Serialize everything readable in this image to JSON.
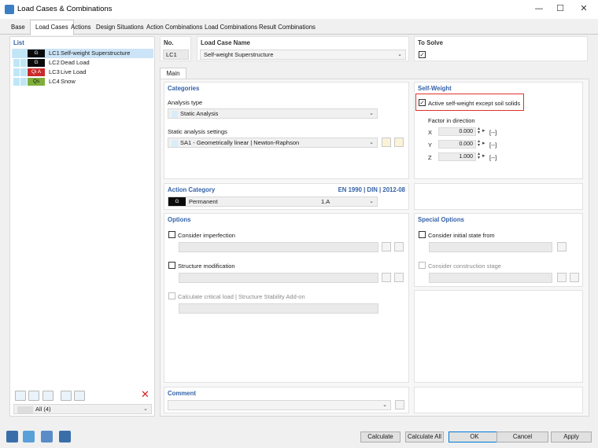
{
  "window": {
    "title": "Load Cases & Combinations",
    "minimize": "—",
    "maximize": "☐",
    "close": "✕"
  },
  "tabs": [
    "Base",
    "Load Cases",
    "Actions",
    "Design Situations",
    "Action Combinations",
    "Load Combinations",
    "Result Combinations"
  ],
  "list": {
    "header": "List",
    "items": [
      {
        "badge": "G",
        "badge_color": "#0b0b0b",
        "code": "LC1",
        "name": "Self-weight Superstructure"
      },
      {
        "badge": "G",
        "badge_color": "#0b0b0b",
        "code": "LC2",
        "name": "Dead Load"
      },
      {
        "badge": "Qi A",
        "badge_color": "#c92b2b",
        "code": "LC3",
        "name": "Live Load"
      },
      {
        "badge": "Qs",
        "badge_color": "#7fae3c",
        "code": "LC4",
        "name": "Snow"
      }
    ],
    "filter": "All (4)"
  },
  "header": {
    "no_label": "No.",
    "no_value": "LC1",
    "name_label": "Load Case Name",
    "name_value": "Self-weight Superstructure",
    "solve_label": "To Solve",
    "solve_checked": "✓"
  },
  "main_tab": "Main",
  "categories": {
    "title": "Categories",
    "analysis_type_label": "Analysis type",
    "analysis_type_value": "Static Analysis",
    "static_settings_label": "Static analysis settings",
    "static_settings_value": "SA1 - Geometrically linear | Newton-Raphson"
  },
  "self_weight": {
    "title": "Self-Weight",
    "active_label": "Active self-weight except soil solids",
    "active_checked": "✓",
    "factor_label": "Factor in direction",
    "x_label": "X",
    "x_value": "0.000",
    "y_label": "Y",
    "y_value": "0.000",
    "z_label": "Z",
    "z_value": "1.000",
    "unit": "[--]"
  },
  "action_category": {
    "title": "Action Category",
    "standard": "EN 1990 | DIN | 2012-08",
    "badge": "G",
    "value": "Permanent",
    "code": "1.A"
  },
  "options": {
    "title": "Options",
    "imperfection": "Consider imperfection",
    "structure_mod": "Structure modification",
    "critical_load": "Calculate critical load | Structure Stability Add-on"
  },
  "special_options": {
    "title": "Special Options",
    "initial_state": "Consider initial state from",
    "construction_stage": "Consider construction stage"
  },
  "comment": {
    "title": "Comment"
  },
  "buttons": {
    "calculate": "Calculate",
    "calculate_all": "Calculate All",
    "ok": "OK",
    "cancel": "Cancel",
    "apply": "Apply"
  },
  "colors": {
    "accent": "#3462a8",
    "highlight": "#e0322f",
    "selection": "#cce4f7"
  }
}
